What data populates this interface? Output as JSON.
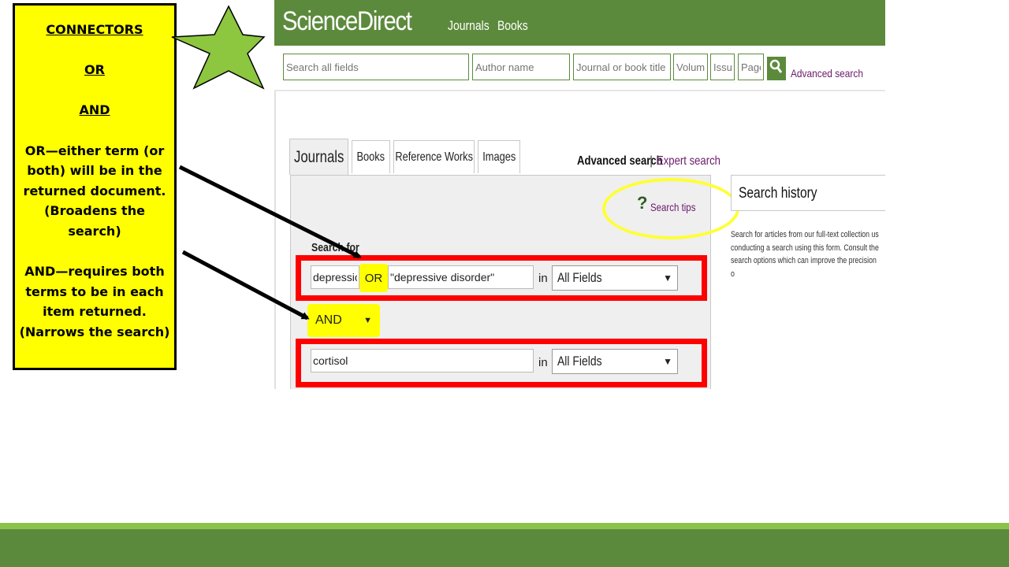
{
  "callout": {
    "heading": "CONNECTORS",
    "or_label": "OR",
    "and_label": "AND",
    "or_desc": [
      "OR—either term (or",
      "both) will be in the",
      "returned document.",
      "(Broadens the",
      "search)"
    ],
    "and_desc": [
      "AND—requires both",
      "terms to be in each",
      "item returned.",
      "(Narrows the search)"
    ]
  },
  "colors": {
    "brand_green": "#5c8a3c",
    "highlight_yellow": "#ffff00",
    "outline_red": "#ff0000",
    "link_purple": "#6a1b6a",
    "star_green": "#8dc63f"
  },
  "header": {
    "logo": "ScienceDirect",
    "nav": [
      "Journals",
      "Books"
    ]
  },
  "quick_search": {
    "all_fields_placeholder": "Search all fields",
    "author_placeholder": "Author name",
    "journal_placeholder": "Journal or book title",
    "volume_placeholder": "Volume",
    "issue_placeholder": "Issue",
    "page_placeholder": "Page",
    "search_icon": "magnifier-icon",
    "advanced_link": "Advanced search"
  },
  "tabs": [
    "Journals",
    "Books",
    "Reference Works",
    "Images"
  ],
  "search_modes": {
    "advanced": "Advanced search",
    "separator": "|",
    "expert": "Expert search"
  },
  "form": {
    "search_tips_icon": "?",
    "search_tips": "Search tips",
    "search_for_label": "Search for",
    "term1": "depression",
    "or_connector": "OR",
    "term2": "\"depressive disorder\"",
    "in_label": "in",
    "field_select_1": "All Fields",
    "and_connector": "AND",
    "term3": "cortisol",
    "field_select_2": "All Fields",
    "dropdown_arrow": "▼"
  },
  "history": {
    "title": "Search history",
    "desc": [
      "Search for articles from our full-text collection us",
      "conducting a search using this form. Consult the",
      "search options which can improve the precision o"
    ]
  }
}
